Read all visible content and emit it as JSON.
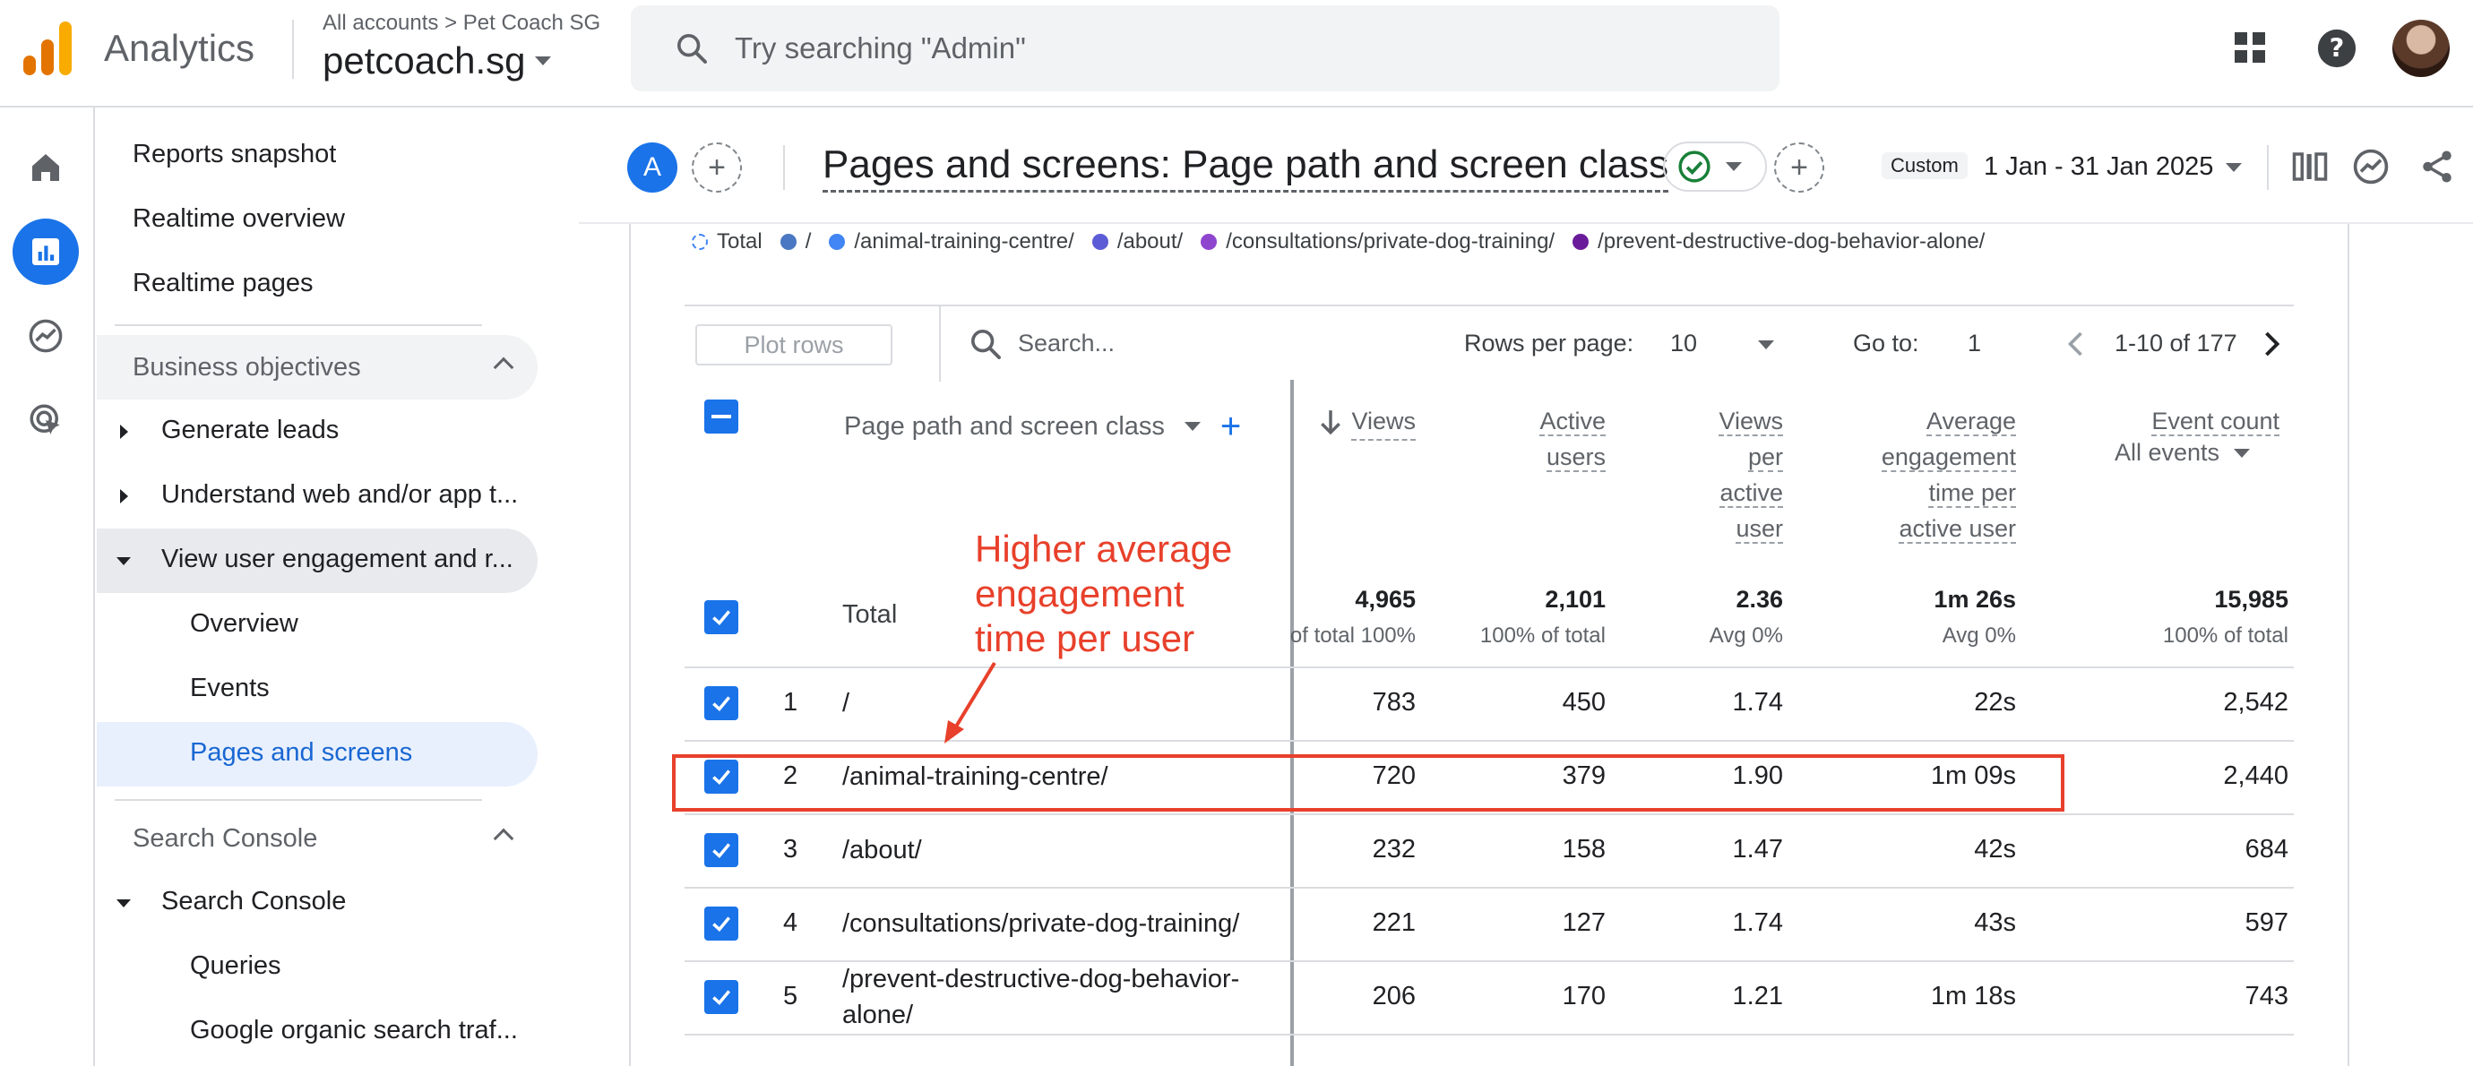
{
  "topbar": {
    "product_name": "Analytics",
    "account_crumb": "All accounts > Pet Coach SG",
    "account_name": "petcoach.sg",
    "search_placeholder": "Try searching \"Admin\"",
    "icons": [
      "apps-grid-icon",
      "help-icon",
      "avatar"
    ]
  },
  "rail": {
    "items": [
      "home-icon",
      "reports-icon",
      "explore-icon",
      "advertising-icon"
    ],
    "active_index": 1
  },
  "nav": {
    "reports_snapshot": "Reports snapshot",
    "realtime_overview": "Realtime overview",
    "realtime_pages": "Realtime pages",
    "business_objectives": "Business objectives",
    "generate_leads": "Generate leads",
    "understand_traffic": "Understand web and/or app t...",
    "view_engagement": "View user engagement and r...",
    "overview": "Overview",
    "events": "Events",
    "pages_and_screens": "Pages and screens",
    "search_console_section": "Search Console",
    "search_console": "Search Console",
    "queries": "Queries",
    "google_organic": "Google organic search traf..."
  },
  "report": {
    "avatar_letter": "A",
    "title": "Pages and screens: Page path and screen class",
    "custom_label": "Custom",
    "date_range": "1 Jan - 31 Jan 2025",
    "accent_color": "#1a73e8",
    "status_color": "#188038"
  },
  "legend": [
    {
      "label": "Total",
      "color": "#4285f4",
      "dashed": true
    },
    {
      "label": "/",
      "color": "#4a78c2"
    },
    {
      "label": "/animal-training-centre/",
      "color": "#4285f4"
    },
    {
      "label": "/about/",
      "color": "#5c5cd6"
    },
    {
      "label": "/consultations/private-dog-training/",
      "color": "#8f46cf"
    },
    {
      "label": "/prevent-destructive-dog-behavior-alone/",
      "color": "#6a1b9a"
    }
  ],
  "toolbar": {
    "plot_rows": "Plot rows",
    "search_placeholder": "Search...",
    "rows_per_page_label": "Rows per page:",
    "rows_per_page_value": "10",
    "goto_label": "Go to:",
    "goto_value": "1",
    "pagination": "1-10 of 177"
  },
  "table": {
    "dimension_header": "Page path and screen class",
    "headers": {
      "views": "Views",
      "active_users": [
        "Active",
        "users"
      ],
      "views_per_user": [
        "Views",
        "per",
        "active",
        "user"
      ],
      "avg_engagement": [
        "Average",
        "engagement",
        "time per",
        "active user"
      ],
      "event_count": "Event count",
      "event_filter": "All events"
    },
    "totals": {
      "label": "Total",
      "views": "4,965",
      "views_sub": "100% of total",
      "active_users": "2,101",
      "active_users_sub": "100% of total",
      "views_per_user": "2.36",
      "views_per_user_sub": "Avg 0%",
      "avg_engagement": "1m 26s",
      "avg_engagement_sub": "Avg 0%",
      "event_count": "15,985",
      "event_count_sub": "100% of total"
    },
    "rows": [
      {
        "index": "1",
        "path": "/",
        "views": "783",
        "active_users": "450",
        "views_per_user": "1.74",
        "avg_engagement": "22s",
        "event_count": "2,542",
        "checked": true
      },
      {
        "index": "2",
        "path": "/animal-training-centre/",
        "views": "720",
        "active_users": "379",
        "views_per_user": "1.90",
        "avg_engagement": "1m 09s",
        "event_count": "2,440",
        "checked": true
      },
      {
        "index": "3",
        "path": "/about/",
        "views": "232",
        "active_users": "158",
        "views_per_user": "1.47",
        "avg_engagement": "42s",
        "event_count": "684",
        "checked": true
      },
      {
        "index": "4",
        "path": "/consultations/private-dog-training/",
        "views": "221",
        "active_users": "127",
        "views_per_user": "1.74",
        "avg_engagement": "43s",
        "event_count": "597",
        "checked": true
      },
      {
        "index": "5",
        "path": "/prevent-destructive-dog-behavior-alone/",
        "views": "206",
        "active_users": "170",
        "views_per_user": "1.21",
        "avg_engagement": "1m 18s",
        "event_count": "743",
        "checked": true
      }
    ]
  },
  "annotation": {
    "lines": [
      "Higher average",
      "engagement",
      "time per user"
    ],
    "color": "#e8402b"
  }
}
